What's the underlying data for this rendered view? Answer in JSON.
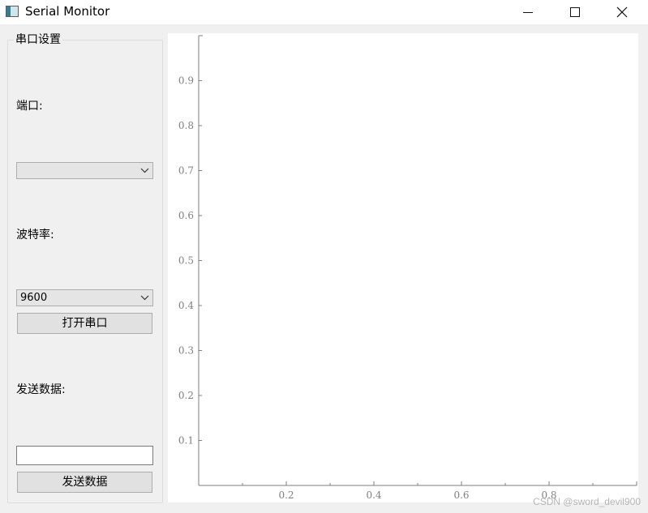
{
  "window": {
    "title": "Serial Monitor"
  },
  "icons": {
    "app": "app-window-icon",
    "minimize": "minimize-icon",
    "maximize": "maximize-icon",
    "close": "close-icon",
    "dropdown": "chevron-down-icon"
  },
  "settings": {
    "group_title": "串口设置",
    "port_label": "端口:",
    "port_value": "",
    "baud_label": "波特率:",
    "baud_value": "9600",
    "open_button": "打开串口",
    "send_label": "发送数据:",
    "send_input_value": "",
    "send_button": "发送数据"
  },
  "colors": {
    "window_bg": "#f0f0f0",
    "plot_bg": "#ffffff",
    "axis": "#7f7f7f"
  },
  "chart_data": {
    "type": "line",
    "series": [],
    "xlim": [
      0,
      1
    ],
    "ylim": [
      0,
      1
    ],
    "xticks": [
      0.2,
      0.4,
      0.6,
      0.8
    ],
    "yticks": [
      0.1,
      0.2,
      0.3,
      0.4,
      0.5,
      0.6,
      0.7,
      0.8,
      0.9
    ],
    "xtick_labels": [
      "0.2",
      "0.4",
      "0.6",
      "0.8"
    ],
    "ytick_labels": [
      "0.1",
      "0.2",
      "0.3",
      "0.4",
      "0.5",
      "0.6",
      "0.7",
      "0.8",
      "0.9"
    ],
    "grid": false
  },
  "watermark": "CSDN @sword_devil900"
}
